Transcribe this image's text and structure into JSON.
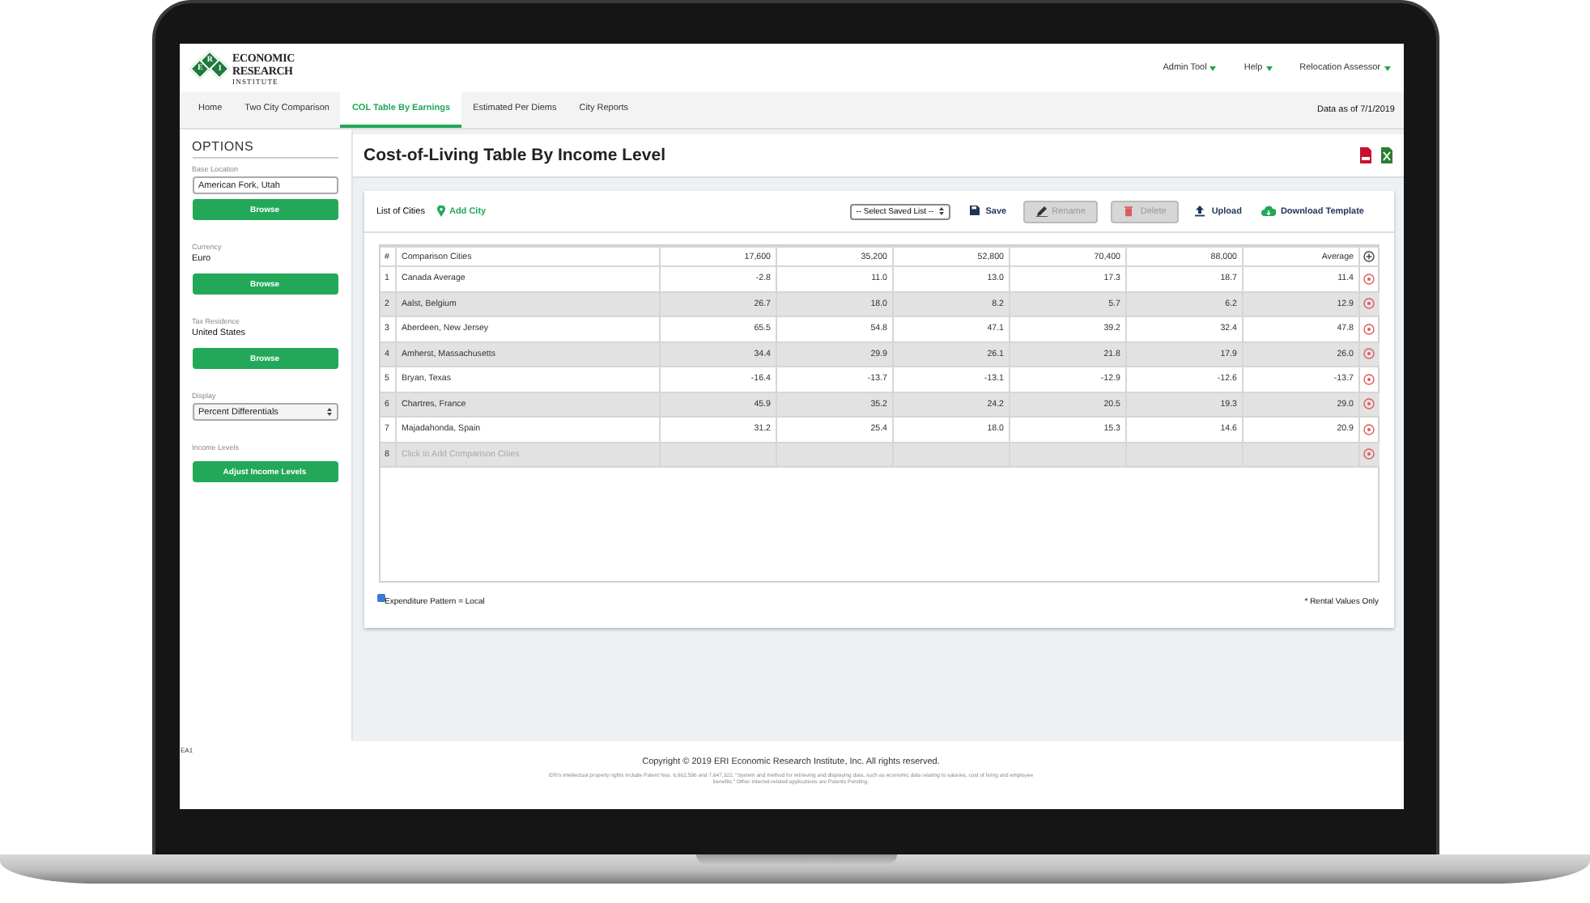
{
  "header": {
    "logo": {
      "letters": [
        "E",
        "R",
        "I"
      ],
      "lines": [
        "ECONOMIC",
        "RESEARCH",
        "INSTITUTE"
      ]
    },
    "menus": [
      "Admin Tool",
      "Help",
      "Relocation Assessor"
    ]
  },
  "nav": {
    "tabs": [
      {
        "label": "Home",
        "selected": false
      },
      {
        "label": "Two City Comparison",
        "selected": false
      },
      {
        "label": "COL Table By Earnings",
        "selected": true
      },
      {
        "label": "Estimated Per Diems",
        "selected": false
      },
      {
        "label": "City Reports",
        "selected": false
      }
    ],
    "data_date": "Data as of 7/1/2019"
  },
  "sidebar": {
    "heading": "OPTIONS",
    "fields": [
      {
        "kind": "input",
        "label": "Base Location",
        "value": "American Fork, Utah",
        "button": "Browse"
      },
      {
        "kind": "text",
        "label": "Currency",
        "value": "Euro",
        "button": "Browse"
      },
      {
        "kind": "text",
        "label": "Tax Residence",
        "value": "United States",
        "button": "Browse"
      },
      {
        "kind": "select",
        "label": "Display",
        "value": "Percent Differentials"
      },
      {
        "kind": "button",
        "label": "Income Levels",
        "button": "Adjust Income Levels"
      }
    ]
  },
  "page": {
    "title": "Cost-of-Living Table By Income Level"
  },
  "toolbar": {
    "label": "List of Cities",
    "add": "Add City",
    "saved_list": "-- Select Saved List --",
    "actions": [
      {
        "kind": "save",
        "label": "Save",
        "disabled": false
      },
      {
        "kind": "rename",
        "label": "Rename",
        "disabled": true
      },
      {
        "kind": "delete",
        "label": "Delete",
        "disabled": true
      },
      {
        "kind": "upload",
        "label": "Upload",
        "disabled": false
      },
      {
        "kind": "download",
        "label": "Download Template",
        "disabled": false
      }
    ]
  },
  "table": {
    "columns": [
      "#",
      "Comparison Cities",
      "17,600",
      "35,200",
      "52,800",
      "70,400",
      "88,000",
      "Average"
    ],
    "rows": [
      {
        "number": "1",
        "city": "Canada Average",
        "values": [
          "-2.8",
          "11.0",
          "13.0",
          "17.3",
          "18.7",
          "11.4"
        ]
      },
      {
        "number": "2",
        "city": "Aalst, Belgium",
        "values": [
          "26.7",
          "18.0",
          "8.2",
          "5.7",
          "6.2",
          "12.9"
        ]
      },
      {
        "number": "3",
        "city": "Aberdeen, New Jersey",
        "values": [
          "65.5",
          "54.8",
          "47.1",
          "39.2",
          "32.4",
          "47.8"
        ]
      },
      {
        "number": "4",
        "city": "Amherst, Massachusetts",
        "values": [
          "34.4",
          "29.9",
          "26.1",
          "21.8",
          "17.9",
          "26.0"
        ]
      },
      {
        "number": "5",
        "city": "Bryan, Texas",
        "values": [
          "-16.4",
          "-13.7",
          "-13.1",
          "-12.9",
          "-12.6",
          "-13.7"
        ]
      },
      {
        "number": "6",
        "city": "Chartres, France",
        "values": [
          "45.9",
          "35.2",
          "24.2",
          "20.5",
          "19.3",
          "29.0"
        ]
      },
      {
        "number": "7",
        "city": "Majadahonda, Spain",
        "values": [
          "31.2",
          "25.4",
          "18.0",
          "15.3",
          "14.6",
          "20.9"
        ]
      }
    ],
    "add_row": {
      "number": "8",
      "placeholder": "Click to Add Comparison Cities"
    }
  },
  "notes": {
    "checkbox": {
      "label": "Expenditure Pattern = Local",
      "checked": true
    },
    "footnote": "* Rental Values Only"
  },
  "footer": {
    "code": "EA1",
    "copyright": "Copyright © 2019 ERI Economic Research Institute, Inc. All rights reserved.",
    "patent": "ERI's intellectual property rights include Patent Nos. 6,862,596 and 7,647,322, \"System and method for retrieving and displaying data, such as economic data relating to salaries, cost of living and employee benefits.\" Other Internet-related applications are Patents Pending."
  }
}
